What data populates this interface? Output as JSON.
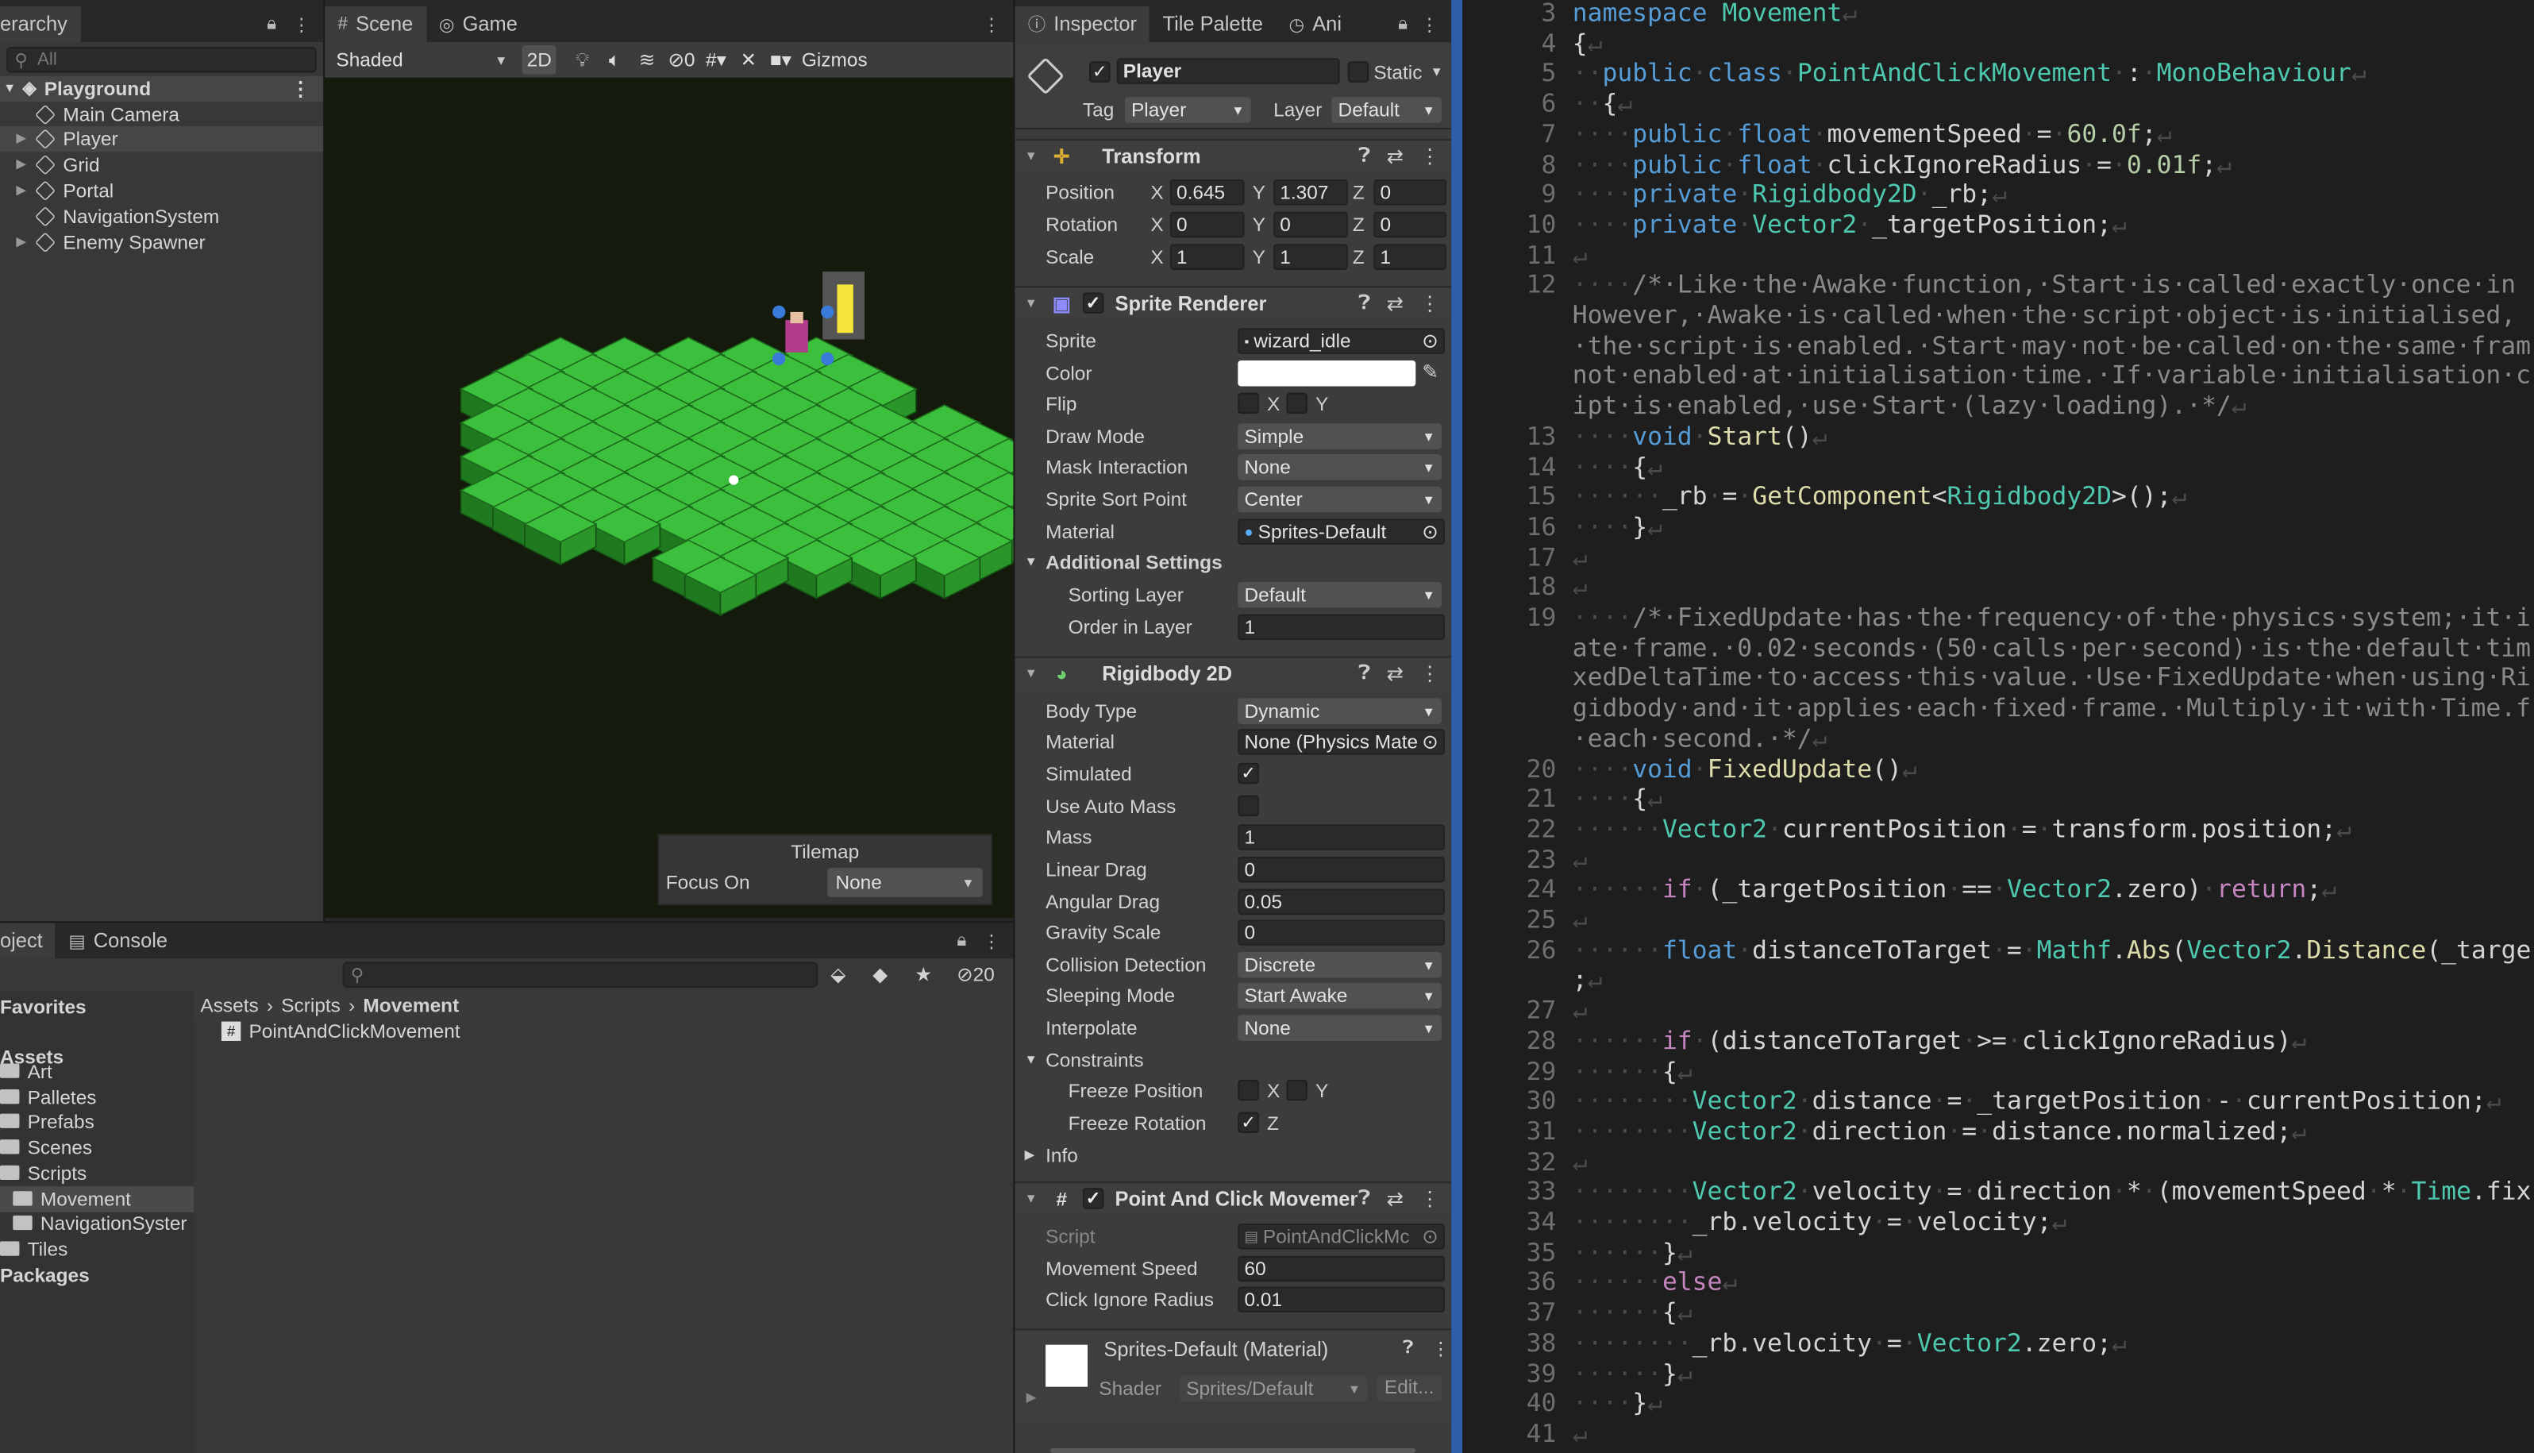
{
  "hierarchy": {
    "tab_label": "erarchy",
    "search_placeholder": "All",
    "scene_name": "Playground",
    "items": [
      "Main Camera",
      "Player",
      "Grid",
      "Portal",
      "NavigationSystem",
      "Enemy Spawner"
    ]
  },
  "scene": {
    "tabs": [
      "Scene",
      "Game"
    ],
    "shading": "Shaded",
    "mode_2d": "2D",
    "hidden_count": "0",
    "gizmos_label": "Gizmos",
    "tilemap_overlay": {
      "title": "Tilemap",
      "focus_label": "Focus On",
      "focus_value": "None"
    }
  },
  "project": {
    "tab_label": "oject",
    "console_label": "Console",
    "hidden_count": "20",
    "favorites_label": "Favorites",
    "assets_label": "Assets",
    "folders": [
      "Art",
      "Palletes",
      "Prefabs",
      "Scenes",
      "Scripts",
      "Movement",
      "NavigationSyster",
      "Tiles"
    ],
    "packages_label": "Packages",
    "breadcrumb": [
      "Assets",
      "Scripts",
      "Movement"
    ],
    "files": [
      "PointAndClickMovement"
    ]
  },
  "inspector": {
    "tabs": [
      "Inspector",
      "Tile Palette",
      "Ani"
    ],
    "object_name": "Player",
    "static_label": "Static",
    "tag_label": "Tag",
    "tag_value": "Player",
    "layer_label": "Layer",
    "layer_value": "Default",
    "transform": {
      "title": "Transform",
      "position": {
        "label": "Position",
        "x": "0.645",
        "y": "1.307",
        "z": "0"
      },
      "rotation": {
        "label": "Rotation",
        "x": "0",
        "y": "0",
        "z": "0"
      },
      "scale": {
        "label": "Scale",
        "x": "1",
        "y": "1",
        "z": "1"
      }
    },
    "sprite_renderer": {
      "title": "Sprite Renderer",
      "sprite_label": "Sprite",
      "sprite_value": "wizard_idle",
      "color_label": "Color",
      "flip_label": "Flip",
      "draw_mode_label": "Draw Mode",
      "draw_mode_value": "Simple",
      "mask_label": "Mask Interaction",
      "mask_value": "None",
      "sort_point_label": "Sprite Sort Point",
      "sort_point_value": "Center",
      "material_label": "Material",
      "material_value": "Sprites-Default",
      "additional_label": "Additional Settings",
      "sorting_layer_label": "Sorting Layer",
      "sorting_layer_value": "Default",
      "order_label": "Order in Layer",
      "order_value": "1"
    },
    "rigidbody": {
      "title": "Rigidbody 2D",
      "body_type_label": "Body Type",
      "body_type_value": "Dynamic",
      "material_label": "Material",
      "material_value": "None (Physics Mate",
      "simulated_label": "Simulated",
      "auto_mass_label": "Use Auto Mass",
      "mass_label": "Mass",
      "mass_value": "1",
      "linear_drag_label": "Linear Drag",
      "linear_drag_value": "0",
      "angular_drag_label": "Angular Drag",
      "angular_drag_value": "0.05",
      "gravity_label": "Gravity Scale",
      "gravity_value": "0",
      "collision_label": "Collision Detection",
      "collision_value": "Discrete",
      "sleeping_label": "Sleeping Mode",
      "sleeping_value": "Start Awake",
      "interpolate_label": "Interpolate",
      "interpolate_value": "None",
      "constraints_label": "Constraints",
      "freeze_pos_label": "Freeze Position",
      "freeze_rot_label": "Freeze Rotation",
      "info_label": "Info"
    },
    "script_comp": {
      "title": "Point And Click Movemen",
      "script_label": "Script",
      "script_value": "PointAndClickMc",
      "speed_label": "Movement Speed",
      "speed_value": "60",
      "radius_label": "Click Ignore Radius",
      "radius_value": "0.01"
    },
    "material_comp": {
      "title": "Sprites-Default (Material)",
      "shader_label": "Shader",
      "shader_value": "Sprites/Default",
      "edit_label": "Edit..."
    },
    "axis_labels": {
      "x": "X",
      "y": "Y",
      "z": "Z"
    }
  },
  "code": {
    "lines": [
      {
        "n": "3",
        "html": "<span class='k'>namespace</span> <span class='t'>Movement</span><span class='ws'>↵</span>"
      },
      {
        "n": "4",
        "html": "{<span class='ws'>↵</span>"
      },
      {
        "n": "5",
        "html": "<span class='ws'>··</span><span class='k'>public</span><span class='ws'>·</span><span class='k'>class</span><span class='ws'>·</span><span class='t'>PointAndClickMovement</span><span class='ws'>·</span>:<span class='ws'>·</span><span class='t'>MonoBehaviour</span><span class='ws'>↵</span>"
      },
      {
        "n": "6",
        "html": "<span class='ws'>··</span>{<span class='ws'>↵</span>"
      },
      {
        "n": "7",
        "html": "<span class='ws'>····</span><span class='k'>public</span><span class='ws'>·</span><span class='k'>float</span><span class='ws'>·</span>movementSpeed<span class='ws'>·</span>=<span class='ws'>·</span><span class='n'>60.0f</span>;<span class='ws'>↵</span>"
      },
      {
        "n": "8",
        "html": "<span class='ws'>····</span><span class='k'>public</span><span class='ws'>·</span><span class='k'>float</span><span class='ws'>·</span>clickIgnoreRadius<span class='ws'>·</span>=<span class='ws'>·</span><span class='n'>0.01f</span>;<span class='ws'>↵</span>"
      },
      {
        "n": "9",
        "html": "<span class='ws'>····</span><span class='k'>private</span><span class='ws'>·</span><span class='t'>Rigidbody2D</span><span class='ws'>·</span>_rb;<span class='ws'>↵</span>"
      },
      {
        "n": "10",
        "html": "<span class='ws'>····</span><span class='k'>private</span><span class='ws'>·</span><span class='t'>Vector2</span><span class='ws'>·</span>_targetPosition;<span class='ws'>↵</span>"
      },
      {
        "n": "11",
        "html": "<span class='ws'>↵</span>"
      },
      {
        "n": "12",
        "html": "<span class='ws'>····</span><span class='c'>/*·Like·the·Awake·function,·Start·is·called·exactly·once·in</span>"
      },
      {
        "n": "",
        "html": "<span class='c'>However,·Awake·is·called·when·the·script·object·is·initialised,</span>"
      },
      {
        "n": "",
        "html": "<span class='c'>·the·script·is·enabled.·Start·may·not·be·called·on·the·same·fram</span>"
      },
      {
        "n": "",
        "html": "<span class='c'>not·enabled·at·initialisation·time.·If·variable·initialisation·c</span>"
      },
      {
        "n": "",
        "html": "<span class='c'>ipt·is·enabled,·use·Start·(lazy·loading).·*/</span><span class='ws'>↵</span>"
      },
      {
        "n": "13",
        "html": "<span class='ws'>····</span><span class='k'>void</span><span class='ws'>·</span><span class='y'>Start</span>()<span class='ws'>↵</span>"
      },
      {
        "n": "14",
        "html": "<span class='ws'>····</span>{<span class='ws'>↵</span>"
      },
      {
        "n": "15",
        "html": "<span class='ws'>······</span>_rb<span class='ws'>·</span>=<span class='ws'>·</span><span class='y'>GetComponent</span>&lt;<span class='t'>Rigidbody2D</span>&gt;();<span class='ws'>↵</span>"
      },
      {
        "n": "16",
        "html": "<span class='ws'>····</span>}<span class='ws'>↵</span>"
      },
      {
        "n": "17",
        "html": "<span class='ws'>↵</span>"
      },
      {
        "n": "18",
        "html": "<span class='ws'>↵</span>"
      },
      {
        "n": "19",
        "html": "<span class='ws'>····</span><span class='c'>/*·FixedUpdate·has·the·frequency·of·the·physics·system;·it·i</span>"
      },
      {
        "n": "",
        "html": "<span class='c'>ate·frame.·0.02·seconds·(50·calls·per·second)·is·the·default·tim</span>"
      },
      {
        "n": "",
        "html": "<span class='c'>xedDeltaTime·to·access·this·value.·Use·FixedUpdate·when·using·Ri</span>"
      },
      {
        "n": "",
        "html": "<span class='c'>gidbody·and·it·applies·each·fixed·frame.·Multiply·it·with·Time.f</span>"
      },
      {
        "n": "",
        "html": "<span class='c'>·each·second.·*/</span><span class='ws'>↵</span>"
      },
      {
        "n": "20",
        "html": "<span class='ws'>····</span><span class='k'>void</span><span class='ws'>·</span><span class='y'>FixedUpdate</span>()<span class='ws'>↵</span>"
      },
      {
        "n": "21",
        "html": "<span class='ws'>····</span>{<span class='ws'>↵</span>"
      },
      {
        "n": "22",
        "html": "<span class='ws'>······</span><span class='t'>Vector2</span><span class='ws'>·</span>currentPosition<span class='ws'>·</span>=<span class='ws'>·</span>transform.position;<span class='ws'>↵</span>"
      },
      {
        "n": "23",
        "html": "<span class='ws'>↵</span>"
      },
      {
        "n": "24",
        "html": "<span class='ws'>······</span><span class='p'>if</span><span class='ws'>·</span>(_targetPosition<span class='ws'>·</span>==<span class='ws'>·</span><span class='t'>Vector2</span>.zero)<span class='ws'>·</span><span class='p'>return</span>;<span class='ws'>↵</span>"
      },
      {
        "n": "25",
        "html": "<span class='ws'>↵</span>"
      },
      {
        "n": "26",
        "html": "<span class='ws'>······</span><span class='k'>float</span><span class='ws'>·</span>distanceToTarget<span class='ws'>·</span>=<span class='ws'>·</span><span class='t'>Mathf</span>.<span class='y'>Abs</span>(<span class='t'>Vector2</span>.<span class='y'>Distance</span>(_targe"
      },
      {
        "n": "",
        "html": ";<span class='ws'>↵</span>"
      },
      {
        "n": "27",
        "html": "<span class='ws'>↵</span>"
      },
      {
        "n": "28",
        "html": "<span class='ws'>······</span><span class='p'>if</span><span class='ws'>·</span>(distanceToTarget<span class='ws'>·</span>&gt;=<span class='ws'>·</span>clickIgnoreRadius)<span class='ws'>↵</span>"
      },
      {
        "n": "29",
        "html": "<span class='ws'>······</span>{<span class='ws'>↵</span>"
      },
      {
        "n": "30",
        "html": "<span class='ws'>········</span><span class='t'>Vector2</span><span class='ws'>·</span>distance<span class='ws'>·</span>=<span class='ws'>·</span>_targetPosition<span class='ws'>·</span>-<span class='ws'>·</span>currentPosition;<span class='ws'>↵</span>"
      },
      {
        "n": "31",
        "html": "<span class='ws'>········</span><span class='t'>Vector2</span><span class='ws'>·</span>direction<span class='ws'>·</span>=<span class='ws'>·</span>distance.normalized;<span class='ws'>↵</span>"
      },
      {
        "n": "32",
        "html": "<span class='ws'>↵</span>"
      },
      {
        "n": "33",
        "html": "<span class='ws'>········</span><span class='t'>Vector2</span><span class='ws'>·</span>velocity<span class='ws'>·</span>=<span class='ws'>·</span>direction<span class='ws'>·</span>*<span class='ws'>·</span>(movementSpeed<span class='ws'>·</span>*<span class='ws'>·</span><span class='t'>Time</span>.fix"
      },
      {
        "n": "34",
        "html": "<span class='ws'>········</span>_rb.velocity<span class='ws'>·</span>=<span class='ws'>·</span>velocity;<span class='ws'>↵</span>"
      },
      {
        "n": "35",
        "html": "<span class='ws'>······</span>}<span class='ws'>↵</span>"
      },
      {
        "n": "36",
        "html": "<span class='ws'>······</span><span class='p'>else</span><span class='ws'>↵</span>"
      },
      {
        "n": "37",
        "html": "<span class='ws'>······</span>{<span class='ws'>↵</span>"
      },
      {
        "n": "38",
        "html": "<span class='ws'>········</span>_rb.velocity<span class='ws'>·</span>=<span class='ws'>·</span><span class='t'>Vector2</span>.zero;<span class='ws'>↵</span>"
      },
      {
        "n": "39",
        "html": "<span class='ws'>······</span>}<span class='ws'>↵</span>"
      },
      {
        "n": "40",
        "html": "<span class='ws'>····</span>}<span class='ws'>↵</span>"
      },
      {
        "n": "41",
        "html": "<span class='ws'>↵</span>"
      }
    ]
  },
  "colors": {
    "code_bg": "#1e1e1e",
    "panel_bg": "#383838",
    "selection": "#2c5fa5",
    "grass": "#3cb83c"
  }
}
